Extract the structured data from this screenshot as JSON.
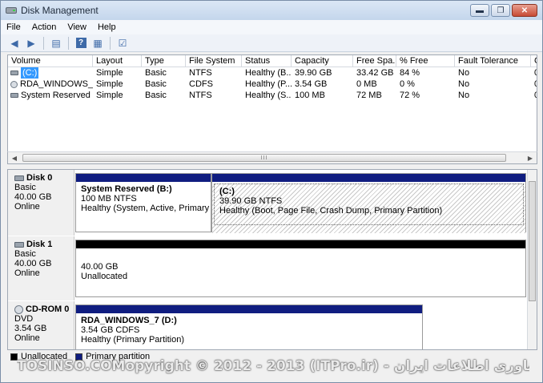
{
  "window": {
    "title": "Disk Management",
    "minimize": "▬",
    "maximize": "❐",
    "close": "✕"
  },
  "menu": [
    "File",
    "Action",
    "View",
    "Help"
  ],
  "list": {
    "columns": [
      "Volume",
      "Layout",
      "Type",
      "File System",
      "Status",
      "Capacity",
      "Free Spa...",
      "% Free",
      "Fault Tolerance",
      "C"
    ],
    "rows": [
      {
        "volume": "(C:)",
        "layout": "Simple",
        "type": "Basic",
        "fs": "NTFS",
        "status": "Healthy (B...",
        "capacity": "39.90 GB",
        "free": "33.42 GB",
        "pct": "84 %",
        "fault": "No",
        "overflow": "0",
        "icon": "disk-icon"
      },
      {
        "volume": "RDA_WINDOWS_7...",
        "layout": "Simple",
        "type": "Basic",
        "fs": "CDFS",
        "status": "Healthy (P...",
        "capacity": "3.54 GB",
        "free": "0 MB",
        "pct": "0 %",
        "fault": "No",
        "overflow": "0",
        "icon": "cd-icon"
      },
      {
        "volume": "System Reserved (...",
        "layout": "Simple",
        "type": "Basic",
        "fs": "NTFS",
        "status": "Healthy (S...",
        "capacity": "100 MB",
        "free": "72 MB",
        "pct": "72 %",
        "fault": "No",
        "overflow": "0",
        "icon": "disk-icon"
      }
    ],
    "scroll_grip": "III"
  },
  "disks": [
    {
      "name": "Disk 0",
      "type": "Basic",
      "size": "40.00 GB",
      "state": "Online",
      "partitions": [
        {
          "name": "System Reserved  (B:)",
          "size": "100 MB NTFS",
          "status": "Healthy (System, Active, Primary Part"
        },
        {
          "name": "(C:)",
          "size": "39.90 GB NTFS",
          "status": "Healthy (Boot, Page File, Crash Dump, Primary Partition)"
        }
      ]
    },
    {
      "name": "Disk 1",
      "type": "Basic",
      "size": "40.00 GB",
      "state": "Online",
      "partitions": [
        {
          "name": "",
          "size": "40.00 GB",
          "status": "Unallocated"
        }
      ]
    },
    {
      "name": "CD-ROM 0",
      "type": "DVD",
      "size": "3.54 GB",
      "state": "Online",
      "partitions": [
        {
          "name": "RDA_WINDOWS_7  (D:)",
          "size": "3.54 GB CDFS",
          "status": "Healthy (Primary Partition)"
        }
      ]
    }
  ],
  "legend": {
    "unallocated": "Unallocated",
    "primary": "Primary partition"
  },
  "watermark": "TOSINSO.COMopyright © 2012 - 2013 (ITPro.ir) - انجمن تخصصی فناوری اطلاعات ایران",
  "colors": {
    "primary_partition": "#101d80",
    "unallocated": "#000000",
    "selection": "#3399ff"
  }
}
